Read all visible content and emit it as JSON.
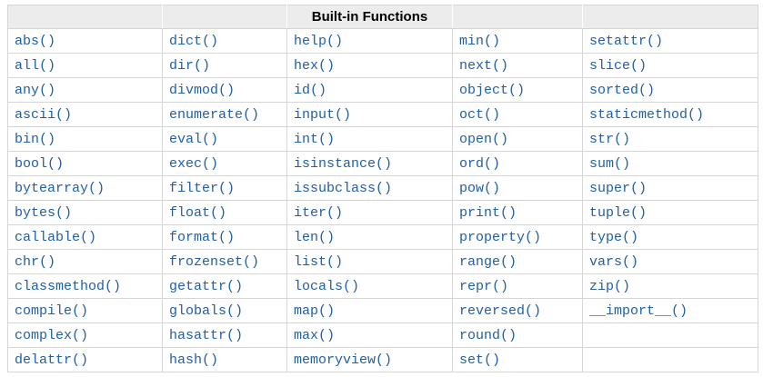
{
  "page": {
    "background": "#ffffff"
  },
  "table": {
    "title": "Built-in Functions",
    "colors": {
      "header_bg": "#ececec",
      "header_text": "#000000",
      "border": "#d6d6d6",
      "header_separator": "#ffffff",
      "link": "#205fa6",
      "cell_bg": "#ffffff"
    },
    "columns": [
      [
        "abs()",
        "all()",
        "any()",
        "ascii()",
        "bin()",
        "bool()",
        "bytearray()",
        "bytes()",
        "callable()",
        "chr()",
        "classmethod()",
        "compile()",
        "complex()",
        "delattr()"
      ],
      [
        "dict()",
        "dir()",
        "divmod()",
        "enumerate()",
        "eval()",
        "exec()",
        "filter()",
        "float()",
        "format()",
        "frozenset()",
        "getattr()",
        "globals()",
        "hasattr()",
        "hash()"
      ],
      [
        "help()",
        "hex()",
        "id()",
        "input()",
        "int()",
        "isinstance()",
        "issubclass()",
        "iter()",
        "len()",
        "list()",
        "locals()",
        "map()",
        "max()",
        "memoryview()"
      ],
      [
        "min()",
        "next()",
        "object()",
        "oct()",
        "open()",
        "ord()",
        "pow()",
        "print()",
        "property()",
        "range()",
        "repr()",
        "reversed()",
        "round()",
        "set()"
      ],
      [
        "setattr()",
        "slice()",
        "sorted()",
        "staticmethod()",
        "str()",
        "sum()",
        "super()",
        "tuple()",
        "type()",
        "vars()",
        "zip()",
        "__import__()",
        "",
        ""
      ]
    ]
  }
}
